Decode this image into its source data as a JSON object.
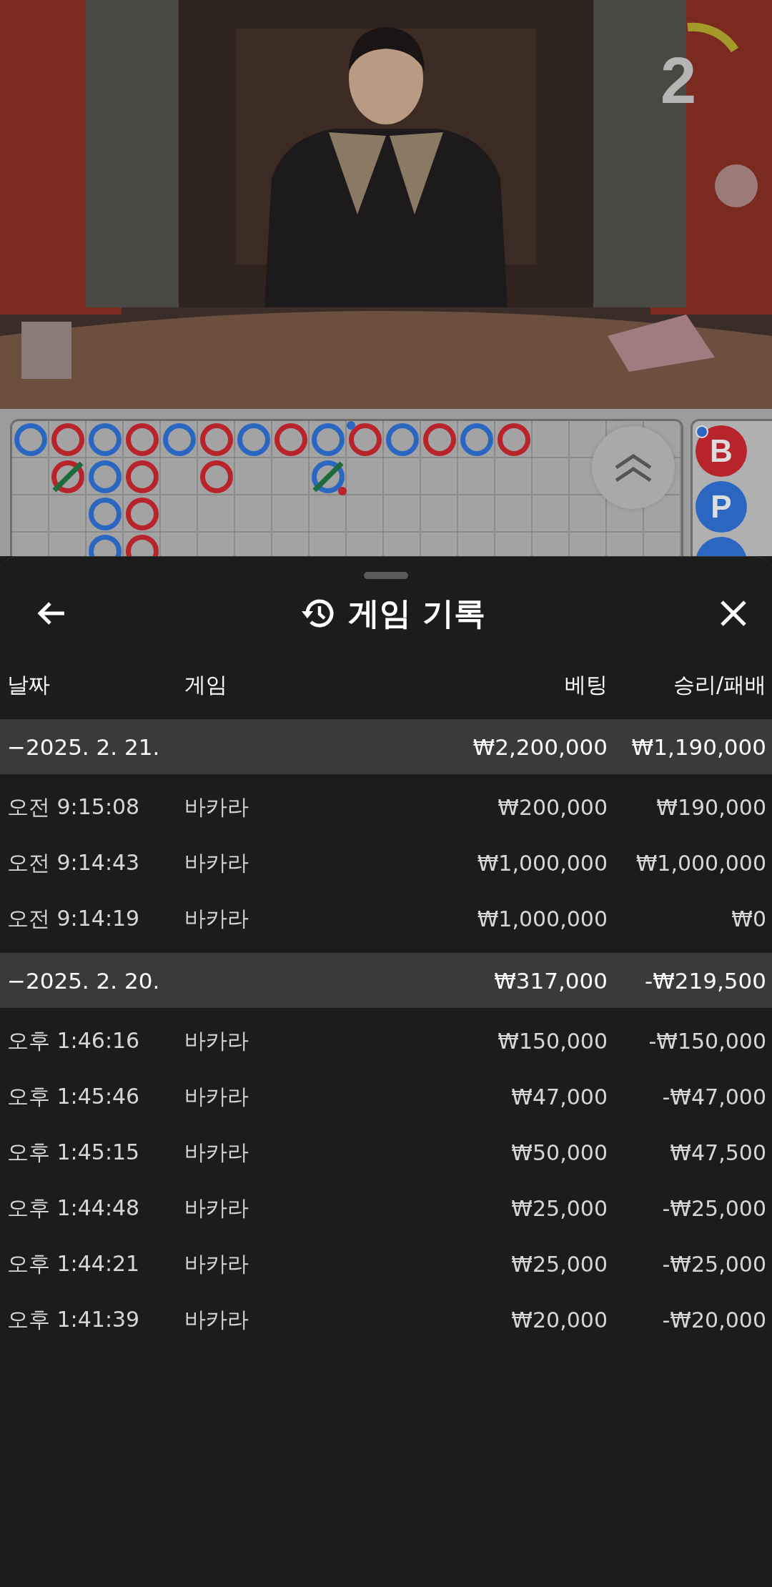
{
  "video": {
    "timer": {
      "value": "2"
    }
  },
  "roadmap": {
    "columns": [
      {
        "cells": [
          {
            "color": "#2b66c0",
            "tie": false,
            "player_pair": false,
            "banker_pair": false
          }
        ]
      },
      {
        "cells": [
          {
            "color": "#b8242c",
            "tie": false,
            "player_pair": false,
            "banker_pair": false
          },
          {
            "color": "#b8242c",
            "tie": true,
            "player_pair": false,
            "banker_pair": false
          }
        ]
      },
      {
        "cells": [
          {
            "color": "#2b66c0",
            "tie": false,
            "player_pair": false,
            "banker_pair": false
          },
          {
            "color": "#2b66c0",
            "tie": false,
            "player_pair": false,
            "banker_pair": false
          },
          {
            "color": "#2b66c0",
            "tie": false,
            "player_pair": false,
            "banker_pair": false
          },
          {
            "color": "#2b66c0",
            "tie": false,
            "player_pair": false
          }
        ]
      },
      {
        "cells": [
          {
            "color": "#b8242c",
            "tie": false,
            "player_pair": false,
            "banker_pair": false
          },
          {
            "color": "#b8242c",
            "tie": false,
            "player_pair": false,
            "banker_pair": false
          },
          {
            "color": "#b8242c",
            "tie": false,
            "player_pair": false,
            "banker_pair": false
          },
          {
            "color": "#b8242c",
            "tie": false,
            "player_pair": false
          }
        ]
      },
      {
        "cells": [
          {
            "color": "#2b66c0",
            "tie": false,
            "player_pair": false,
            "banker_pair": false
          }
        ]
      },
      {
        "cells": [
          {
            "color": "#b8242c",
            "tie": false,
            "player_pair": false,
            "banker_pair": false
          },
          {
            "color": "#b8242c",
            "tie": false,
            "player_pair": false,
            "banker_pair": false
          }
        ]
      },
      {
        "cells": [
          {
            "color": "#2b66c0",
            "tie": false,
            "player_pair": false,
            "banker_pair": false
          }
        ]
      },
      {
        "cells": [
          {
            "color": "#b8242c",
            "tie": false,
            "player_pair": false,
            "banker_pair": false
          }
        ]
      },
      {
        "cells": [
          {
            "color": "#2b66c0",
            "tie": false,
            "player_pair": false,
            "banker_pair": false
          },
          {
            "color": "#2b66c0",
            "tie": true,
            "player_pair": false,
            "banker_pair": true
          }
        ]
      },
      {
        "cells": [
          {
            "color": "#b8242c",
            "tie": false,
            "player_pair": true,
            "banker_pair": false
          }
        ]
      },
      {
        "cells": [
          {
            "color": "#2b66c0",
            "tie": false,
            "player_pair": false,
            "banker_pair": false
          }
        ]
      },
      {
        "cells": [
          {
            "color": "#b8242c",
            "tie": false,
            "player_pair": false,
            "banker_pair": false
          }
        ]
      },
      {
        "cells": [
          {
            "color": "#2b66c0",
            "tie": false,
            "player_pair": false,
            "banker_pair": false
          }
        ]
      },
      {
        "cells": [
          {
            "color": "#b8242c",
            "tie": false,
            "player_pair": false,
            "banker_pair": false
          }
        ]
      }
    ],
    "beads": [
      {
        "label": "B",
        "color": "#b8242c",
        "player_pair": true
      },
      {
        "label": "P",
        "color": "#2b66c0",
        "player_pair": false
      },
      {
        "color": "#2b66c0",
        "player_pair": false
      }
    ]
  },
  "sheet": {
    "title": "게임 기록",
    "columns": [
      "날짜",
      "게임",
      "베팅",
      "승리/패배"
    ],
    "groups": [
      {
        "date": "−2025. 2. 21.",
        "bet": "₩2,200,000",
        "result": "₩1,190,000",
        "rows": [
          {
            "time": "오전 9:15:08",
            "game": "바카라",
            "bet": "₩200,000",
            "result": "₩190,000"
          },
          {
            "time": "오전 9:14:43",
            "game": "바카라",
            "bet": "₩1,000,000",
            "result": "₩1,000,000"
          },
          {
            "time": "오전 9:14:19",
            "game": "바카라",
            "bet": "₩1,000,000",
            "result": "₩0"
          }
        ]
      },
      {
        "date": "−2025. 2. 20.",
        "bet": "₩317,000",
        "result": "-₩219,500",
        "rows": [
          {
            "time": "오후 1:46:16",
            "game": "바카라",
            "bet": "₩150,000",
            "result": "-₩150,000"
          },
          {
            "time": "오후 1:45:46",
            "game": "바카라",
            "bet": "₩47,000",
            "result": "-₩47,000"
          },
          {
            "time": "오후 1:45:15",
            "game": "바카라",
            "bet": "₩50,000",
            "result": "₩47,500"
          },
          {
            "time": "오후 1:44:48",
            "game": "바카라",
            "bet": "₩25,000",
            "result": "-₩25,000"
          },
          {
            "time": "오후 1:44:21",
            "game": "바카라",
            "bet": "₩25,000",
            "result": "-₩25,000"
          },
          {
            "time": "오후 1:41:39",
            "game": "바카라",
            "bet": "₩20,000",
            "result": "-₩20,000"
          }
        ]
      }
    ]
  }
}
